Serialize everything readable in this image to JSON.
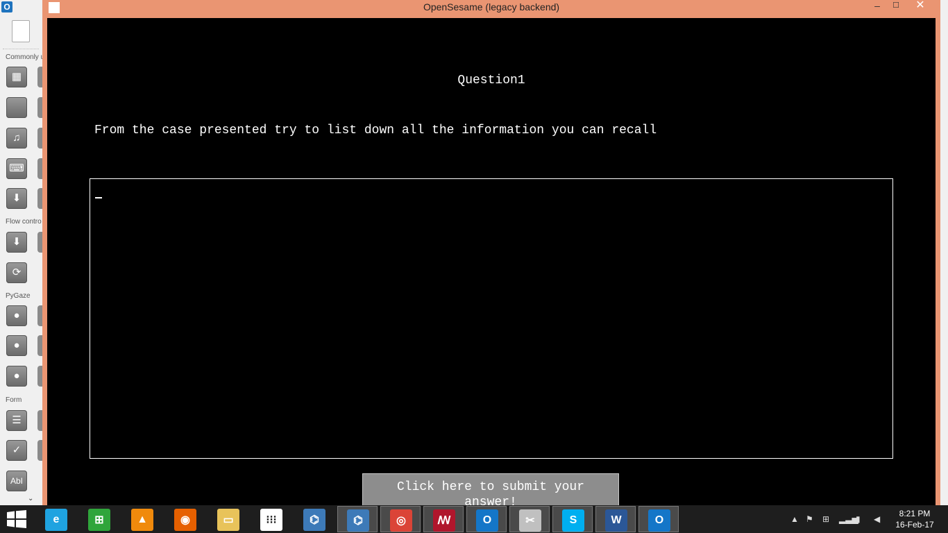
{
  "background_app": {
    "sections": [
      "Commonly u",
      "Flow contro",
      "PyGaze",
      "Form"
    ]
  },
  "window": {
    "title": "OpenSesame (legacy backend)",
    "minimize_icon": "–",
    "maximize_icon": "☐",
    "close_icon": "✕"
  },
  "form": {
    "title": "Question1",
    "question": "From the case presented try to list down all the information you can recall",
    "answer_value": "",
    "submit_label_line1": "Click here to submit your",
    "submit_label_line2": "answer!"
  },
  "taskbar": {
    "start_icon": "windows-logo",
    "apps": [
      {
        "name": "internet-explorer",
        "glyph": "e",
        "color": "#1fa3e0"
      },
      {
        "name": "store",
        "glyph": "⊞",
        "color": "#2fa53b"
      },
      {
        "name": "vlc",
        "glyph": "▲",
        "color": "#f08a0c"
      },
      {
        "name": "firefox",
        "glyph": "◉",
        "color": "#e66000"
      },
      {
        "name": "file-explorer",
        "glyph": "▭",
        "color": "#e8c35a"
      },
      {
        "name": "apps-grid",
        "glyph": "⁝⁝⁝",
        "color": "#ffffff"
      },
      {
        "name": "python",
        "glyph": "⌬",
        "color": "#3d7ab8"
      },
      {
        "name": "python-idle",
        "glyph": "⌬",
        "color": "#3d7ab8"
      },
      {
        "name": "chrome",
        "glyph": "◎",
        "color": "#db4437"
      },
      {
        "name": "mendeley",
        "glyph": "ꟿ",
        "color": "#b0162c"
      },
      {
        "name": "opensesame",
        "glyph": "O",
        "color": "#1476c8"
      },
      {
        "name": "snipping-tool",
        "glyph": "✂",
        "color": "#c0c0c0"
      },
      {
        "name": "skype",
        "glyph": "S",
        "color": "#00aff0"
      },
      {
        "name": "word",
        "glyph": "W",
        "color": "#2b5797"
      },
      {
        "name": "opensesame-running",
        "glyph": "O",
        "color": "#1476c8"
      }
    ],
    "clock_time": "8:21 PM",
    "clock_date": "16-Feb-17"
  }
}
